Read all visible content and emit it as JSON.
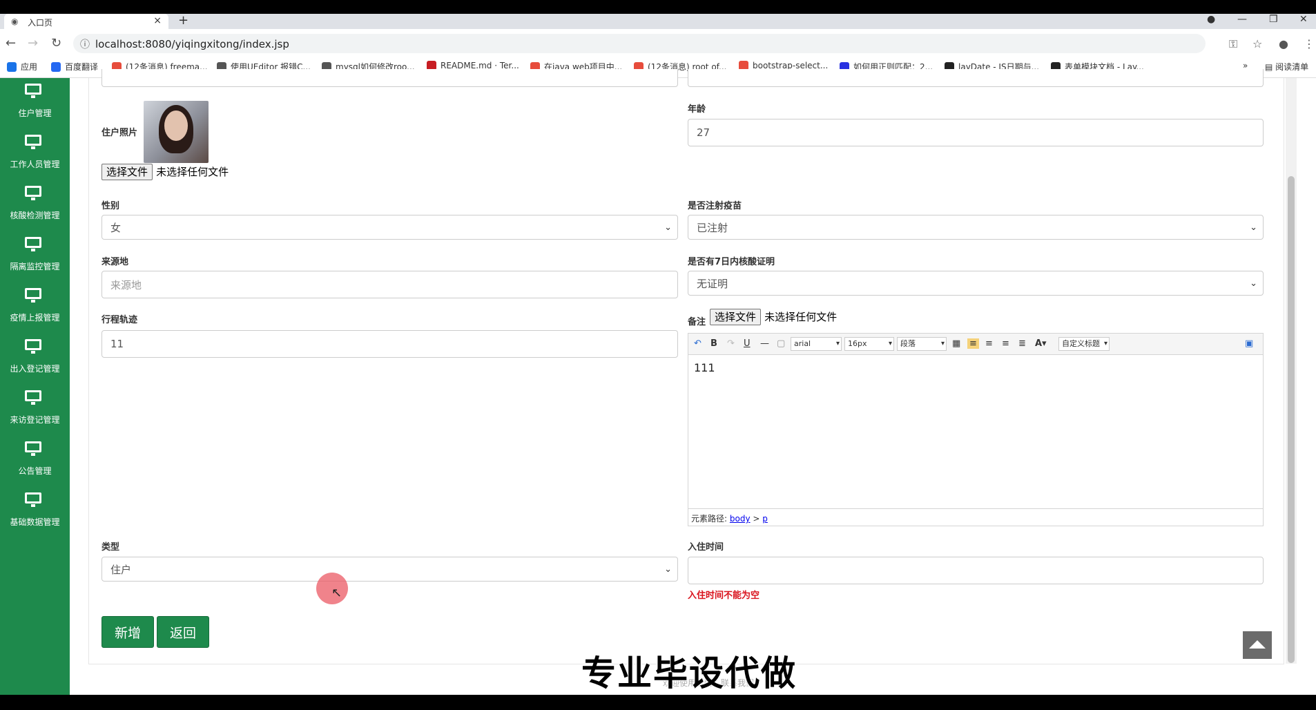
{
  "browser": {
    "tab_title": "入口页",
    "tab_close": "×",
    "new_tab": "+",
    "url": "localhost:8080/yiqingxitong/index.jsp",
    "bookmarks": [
      {
        "label": "应用",
        "color": "#1a73e8"
      },
      {
        "label": "百度翻译",
        "color": "#2468f2"
      },
      {
        "label": "(12条消息) freema...",
        "color": "#e74c3c"
      },
      {
        "label": "使用UEditor 报错C...",
        "color": "#555555"
      },
      {
        "label": "mysql如何修改roo...",
        "color": "#555555"
      },
      {
        "label": "README.md · Ter...",
        "color": "#c71d23"
      },
      {
        "label": "在java web项目中...",
        "color": "#e74c3c"
      },
      {
        "label": "(12条消息) root of...",
        "color": "#e74c3c"
      },
      {
        "label": "bootstrap-select...",
        "color": "#e74c3c"
      },
      {
        "label": "如何用正则匹配：2...",
        "color": "#2932e1"
      },
      {
        "label": "layDate - JS日期与...",
        "color": "#222222"
      },
      {
        "label": "表单模块文档 - Lay...",
        "color": "#222222"
      }
    ],
    "bookmarks_more": "»",
    "reading_list": "阅读清单"
  },
  "sidebar": {
    "items": [
      {
        "label": "住户管理"
      },
      {
        "label": "工作人员管理"
      },
      {
        "label": "核酸检测管理"
      },
      {
        "label": "隔离监控管理"
      },
      {
        "label": "疫情上报管理"
      },
      {
        "label": "出入登记管理"
      },
      {
        "label": "来访登记管理"
      },
      {
        "label": "公告管理"
      },
      {
        "label": "基础数据管理"
      }
    ]
  },
  "form": {
    "photo_label": "住户照片",
    "file_button": "选择文件",
    "file_none": "未选择任何文件",
    "age_label": "年龄",
    "age_value": "27",
    "gender_label": "性别",
    "gender_value": "女",
    "vaccine_label": "是否注射疫苗",
    "vaccine_value": "已注射",
    "origin_label": "来源地",
    "origin_placeholder": "来源地",
    "nucleic_label": "是否有7日内核酸证明",
    "nucleic_value": "无证明",
    "trip_label": "行程轨迹",
    "trip_value": "11",
    "remark_label": "备注",
    "type_label": "类型",
    "type_value": "住户",
    "checkin_label": "入住时间",
    "checkin_value": "",
    "checkin_error": "入住时间不能为空",
    "add_button": "新增",
    "back_button": "返回"
  },
  "editor": {
    "font_family": "arial",
    "font_size": "16px",
    "paragraph": "段落",
    "custom_title": "自定义标题",
    "content": "111",
    "path_label": "元素路径:",
    "path_body": "body",
    "path_sep": ">",
    "path_p": "p"
  },
  "overlay": {
    "watermark": "专业毕设代做",
    "footer": "欢迎使用疫情…联系我们"
  }
}
